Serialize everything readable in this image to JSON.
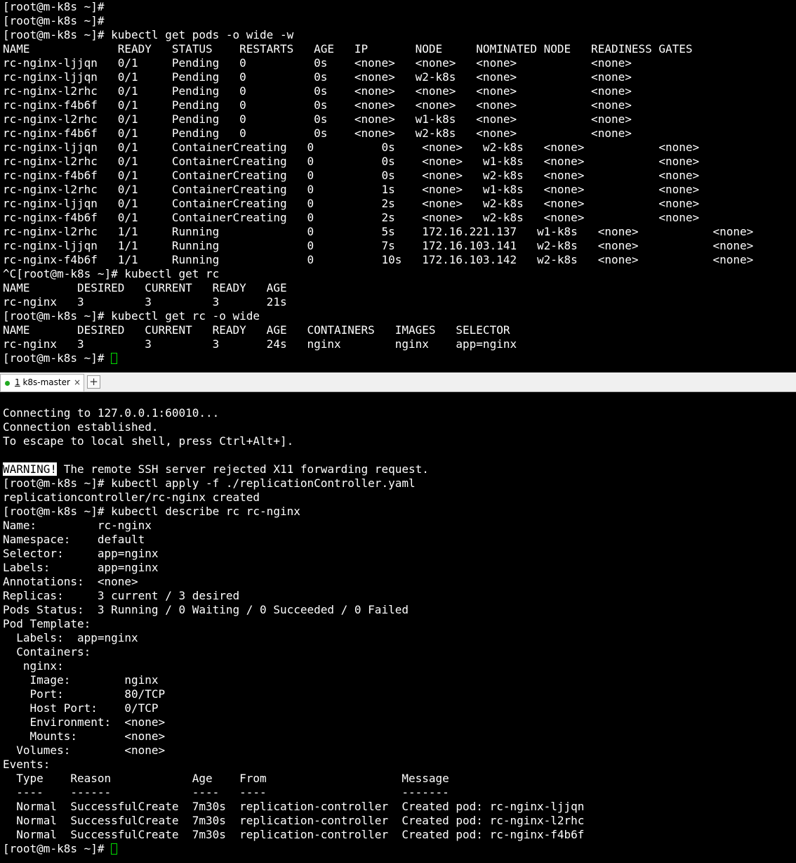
{
  "colors": {
    "background": "#000000",
    "foreground": "#ffffff",
    "cursor": "#00e000",
    "tab_status_dot": "#22aa22"
  },
  "top_pane": {
    "lines": [
      "[root@m-k8s ~]#",
      "[root@m-k8s ~]#",
      "[root@m-k8s ~]# kubectl get pods -o wide -w",
      "NAME             READY   STATUS    RESTARTS   AGE   IP       NODE     NOMINATED NODE   READINESS GATES",
      "rc-nginx-ljjqn   0/1     Pending   0          0s    <none>   <none>   <none>           <none>",
      "rc-nginx-ljjqn   0/1     Pending   0          0s    <none>   w2-k8s   <none>           <none>",
      "rc-nginx-l2rhc   0/1     Pending   0          0s    <none>   <none>   <none>           <none>",
      "rc-nginx-f4b6f   0/1     Pending   0          0s    <none>   <none>   <none>           <none>",
      "rc-nginx-l2rhc   0/1     Pending   0          0s    <none>   w1-k8s   <none>           <none>",
      "rc-nginx-f4b6f   0/1     Pending   0          0s    <none>   w2-k8s   <none>           <none>",
      "rc-nginx-ljjqn   0/1     ContainerCreating   0          0s    <none>   w2-k8s   <none>           <none>",
      "rc-nginx-l2rhc   0/1     ContainerCreating   0          0s    <none>   w1-k8s   <none>           <none>",
      "rc-nginx-f4b6f   0/1     ContainerCreating   0          0s    <none>   w2-k8s   <none>           <none>",
      "rc-nginx-l2rhc   0/1     ContainerCreating   0          1s    <none>   w1-k8s   <none>           <none>",
      "rc-nginx-ljjqn   0/1     ContainerCreating   0          2s    <none>   w2-k8s   <none>           <none>",
      "rc-nginx-f4b6f   0/1     ContainerCreating   0          2s    <none>   w2-k8s   <none>           <none>",
      "rc-nginx-l2rhc   1/1     Running             0          5s    172.16.221.137   w1-k8s   <none>           <none>",
      "rc-nginx-ljjqn   1/1     Running             0          7s    172.16.103.141   w2-k8s   <none>           <none>",
      "rc-nginx-f4b6f   1/1     Running             0          10s   172.16.103.142   w2-k8s   <none>           <none>",
      "^C[root@m-k8s ~]# kubectl get rc",
      "NAME       DESIRED   CURRENT   READY   AGE",
      "rc-nginx   3         3         3       21s",
      "[root@m-k8s ~]# kubectl get rc -o wide",
      "NAME       DESIRED   CURRENT   READY   AGE   CONTAINERS   IMAGES   SELECTOR",
      "rc-nginx   3         3         3       24s   nginx        nginx    app=nginx"
    ],
    "prompt": "[root@m-k8s ~]# "
  },
  "tab_bar": {
    "tab_number": "1",
    "tab_name": " k8s-master",
    "close_glyph": "×",
    "add_glyph": "+"
  },
  "bottom_pane": {
    "lines_before_warning": [
      "",
      "Connecting to 127.0.0.1:60010...",
      "Connection established.",
      "To escape to local shell, press Ctrl+Alt+].",
      ""
    ],
    "warning_label": "WARNING!",
    "warning_text": " The remote SSH server rejected X11 forwarding request.",
    "lines_after_warning": [
      "[root@m-k8s ~]# kubectl apply -f ./replicationController.yaml",
      "replicationcontroller/rc-nginx created",
      "[root@m-k8s ~]# kubectl describe rc rc-nginx",
      "Name:         rc-nginx",
      "Namespace:    default",
      "Selector:     app=nginx",
      "Labels:       app=nginx",
      "Annotations:  <none>",
      "Replicas:     3 current / 3 desired",
      "Pods Status:  3 Running / 0 Waiting / 0 Succeeded / 0 Failed",
      "Pod Template:",
      "  Labels:  app=nginx",
      "  Containers:",
      "   nginx:",
      "    Image:        nginx",
      "    Port:         80/TCP",
      "    Host Port:    0/TCP",
      "    Environment:  <none>",
      "    Mounts:       <none>",
      "  Volumes:        <none>",
      "Events:",
      "  Type    Reason            Age    From                    Message",
      "  ----    ------            ----   ----                    -------",
      "  Normal  SuccessfulCreate  7m30s  replication-controller  Created pod: rc-nginx-ljjqn",
      "  Normal  SuccessfulCreate  7m30s  replication-controller  Created pod: rc-nginx-l2rhc",
      "  Normal  SuccessfulCreate  7m30s  replication-controller  Created pod: rc-nginx-f4b6f"
    ],
    "prompt": "[root@m-k8s ~]# "
  }
}
